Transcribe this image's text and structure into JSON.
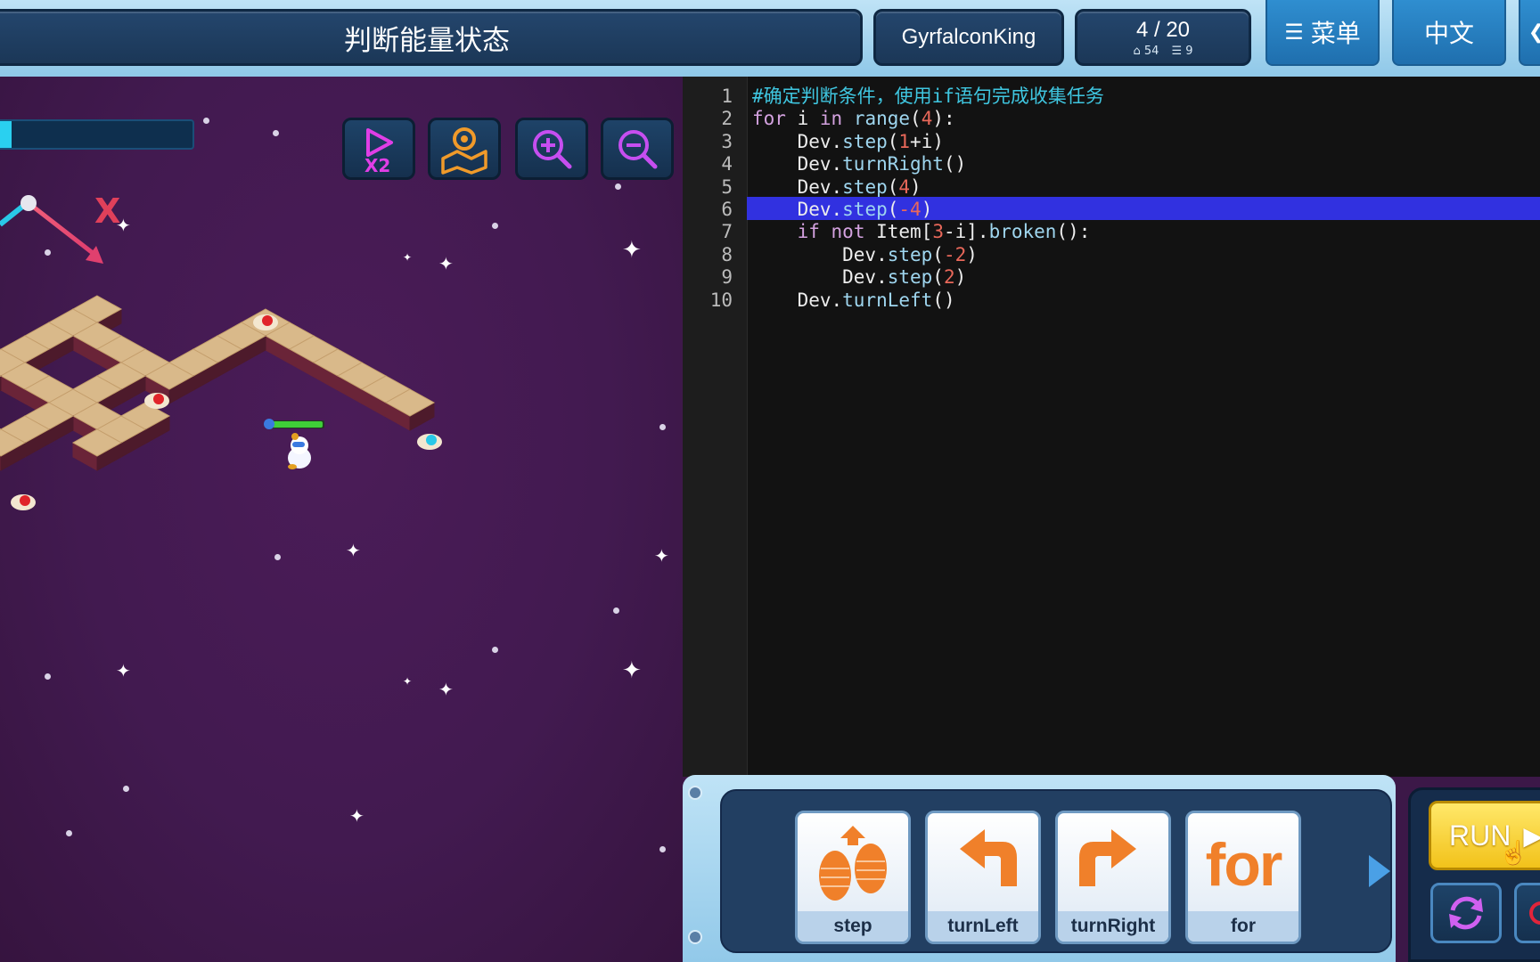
{
  "header": {
    "title": "判断能量状态",
    "username": "GyrfalconKing",
    "level": "4 / 20",
    "stat_a": "54",
    "stat_b": "9",
    "menu_label": "菜单",
    "lang_label": "中文"
  },
  "game": {
    "progress": 0.07,
    "axis_label": "X",
    "tools": [
      "speed-x2-icon",
      "map-icon",
      "zoom-in-icon",
      "zoom-out-icon"
    ],
    "speed_label": "X2"
  },
  "editor": {
    "highlighted_line": 6,
    "lines": [
      {
        "num": "1",
        "text": "#确定判断条件，使用if语句完成收集任务"
      },
      {
        "num": "2",
        "text": "for i in range(4):"
      },
      {
        "num": "3",
        "text": "    Dev.step(1+i)"
      },
      {
        "num": "4",
        "text": "    Dev.turnRight()"
      },
      {
        "num": "5",
        "text": "    Dev.step(4)"
      },
      {
        "num": "6",
        "text": "    Dev.step(-4)"
      },
      {
        "num": "7",
        "text": "    if not Item[3-i].broken():"
      },
      {
        "num": "8",
        "text": "        Dev.step(-2)"
      },
      {
        "num": "9",
        "text": "        Dev.step(2)"
      },
      {
        "num": "10",
        "text": "    Dev.turnLeft()"
      }
    ]
  },
  "commands": [
    {
      "label": "step",
      "icon": "footsteps-icon"
    },
    {
      "label": "turnLeft",
      "icon": "turn-left-arrow-icon"
    },
    {
      "label": "turnRight",
      "icon": "turn-right-arrow-icon"
    },
    {
      "label": "for",
      "icon": "for-loop-icon",
      "glyph": "for"
    }
  ],
  "controls": {
    "run_label": "RUN",
    "reset_icon": "reset-icon"
  },
  "colors": {
    "accent_blue": "#2f8ed0",
    "run_yellow": "#f2c21a",
    "highlight": "#3131e0"
  }
}
